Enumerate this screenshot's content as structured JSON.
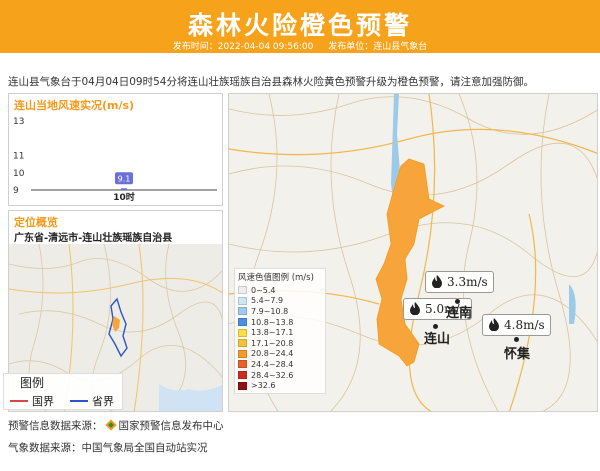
{
  "header": {
    "title": "森林火险橙色预警",
    "publish_time": "发布时间：2022-04-04 09:56:00",
    "publisher": "发布单位：连山县气象台",
    "bg_color": "#f7a21b"
  },
  "summary": "连山县气象台于04月04日09时54分将连山壮族瑶族自治县森林火险黄色预警升级为橙色预警，请注意加强防御。",
  "wind_panel": {
    "title": "连山当地风速实况(m/s)",
    "chart_data": {
      "type": "bar",
      "categories": [
        "10时"
      ],
      "values": [
        9.1
      ],
      "ylim": [
        9,
        13
      ],
      "yticks": [
        "13",
        "11",
        "10",
        "9"
      ],
      "bar_label": "9.1",
      "bar_color": "#6b6fd6"
    }
  },
  "location_panel": {
    "title": "定位概览",
    "region": "广东省-清远市-连山壮族瑶族自治县",
    "legend_title": "图例",
    "legend_items": [
      {
        "label": "国界",
        "color": "#d04848"
      },
      {
        "label": "省界",
        "color": "#2a56c6"
      }
    ]
  },
  "main_map": {
    "wind_legend": {
      "title": "风速色值图例 (m/s)",
      "items": [
        {
          "label": "0~5.4",
          "color": "#eeeeee"
        },
        {
          "label": "5.4~7.9",
          "color": "#cfe6f5"
        },
        {
          "label": "7.9~10.8",
          "color": "#9ecbef"
        },
        {
          "label": "10.8~13.8",
          "color": "#4f8fe3"
        },
        {
          "label": "13.8~17.1",
          "color": "#f6e04a"
        },
        {
          "label": "17.1~20.8",
          "color": "#f7c23a"
        },
        {
          "label": "20.8~24.4",
          "color": "#f39c2a"
        },
        {
          "label": "24.4~28.4",
          "color": "#e4612a"
        },
        {
          "label": "28.4~32.6",
          "color": "#c7301f"
        },
        {
          "label": ">32.6",
          "color": "#8f1212"
        }
      ]
    },
    "stations": [
      {
        "value": "3.3m/s"
      },
      {
        "value": "5.0m/s"
      },
      {
        "value": "4.8m/s"
      }
    ],
    "places": [
      {
        "name": "连南"
      },
      {
        "name": "连山"
      },
      {
        "name": "怀集"
      }
    ],
    "county_fill": "#f7a53a"
  },
  "footer": {
    "warning_source_label": "预警信息数据来源：",
    "warning_source": "国家预警信息发布中心",
    "weather_source": "气象数据来源：中国气象局全国自动站实况"
  }
}
